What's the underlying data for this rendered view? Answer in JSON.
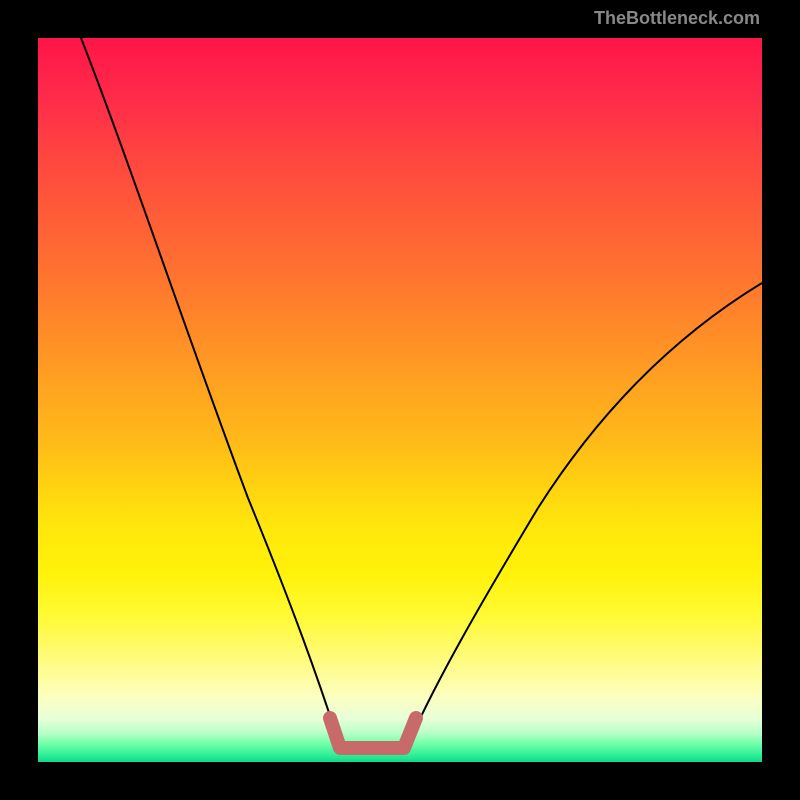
{
  "watermark": "TheBottleneck.com",
  "chart_data": {
    "type": "line",
    "title": "",
    "xlabel": "",
    "ylabel": "",
    "xlim": [
      0,
      100
    ],
    "ylim": [
      0,
      100
    ],
    "grid": false,
    "series": [
      {
        "name": "left-curve",
        "x": [
          6,
          10,
          15,
          20,
          25,
          30,
          35,
          40,
          42
        ],
        "y": [
          100,
          86,
          70,
          56,
          43,
          31,
          20,
          9,
          3
        ]
      },
      {
        "name": "right-curve",
        "x": [
          51,
          55,
          60,
          65,
          70,
          75,
          80,
          85,
          90,
          95,
          100
        ],
        "y": [
          3,
          10,
          18,
          26,
          33,
          40,
          46,
          52,
          57,
          62,
          66
        ]
      },
      {
        "name": "valley-highlight",
        "x": [
          40,
          42,
          50,
          51,
          53
        ],
        "y": [
          9,
          3,
          3,
          3,
          9
        ]
      }
    ],
    "colors": {
      "curve": "#000000",
      "highlight": "#c96a6a"
    }
  }
}
